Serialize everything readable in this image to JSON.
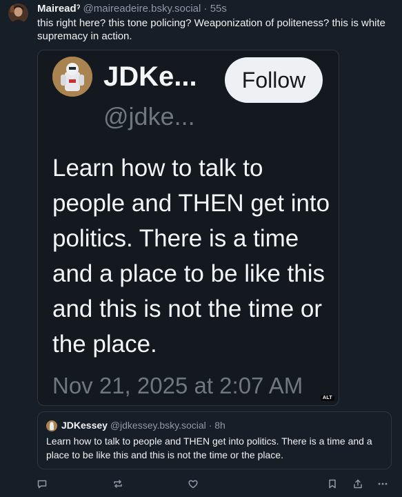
{
  "post": {
    "author_name": "Maireadˀ",
    "handle": "@maireadeire.bsky.social",
    "separator": "·",
    "time": "55s",
    "text": "this right here? this tone policing? Weaponization of politeness? this is white supremacy in action."
  },
  "image": {
    "name": "JDKe...",
    "handle": "@jdke...",
    "follow_label": "Follow",
    "body": "Learn how to talk to people and THEN get into politics. There is a time and a place to be like this and this is not the time or the place.",
    "date": "Nov 21, 2025 at 2:07 AM",
    "alt_label": "ALT"
  },
  "quote": {
    "author_name": "JDKessey",
    "handle": "@jdkessey.bsky.social",
    "separator": "·",
    "time": "8h",
    "text": "Learn how to talk to people and THEN get into politics. There is a time and a place to be like this and this is not the time or the place."
  },
  "actions": {
    "icons": [
      "reply-icon",
      "repost-icon",
      "like-icon",
      "bookmark-icon",
      "share-icon",
      "more-icon"
    ]
  },
  "colors": {
    "background": "#161e27",
    "text": "#f1f3f5",
    "muted": "#8d9aa8",
    "border": "#2c3540"
  }
}
